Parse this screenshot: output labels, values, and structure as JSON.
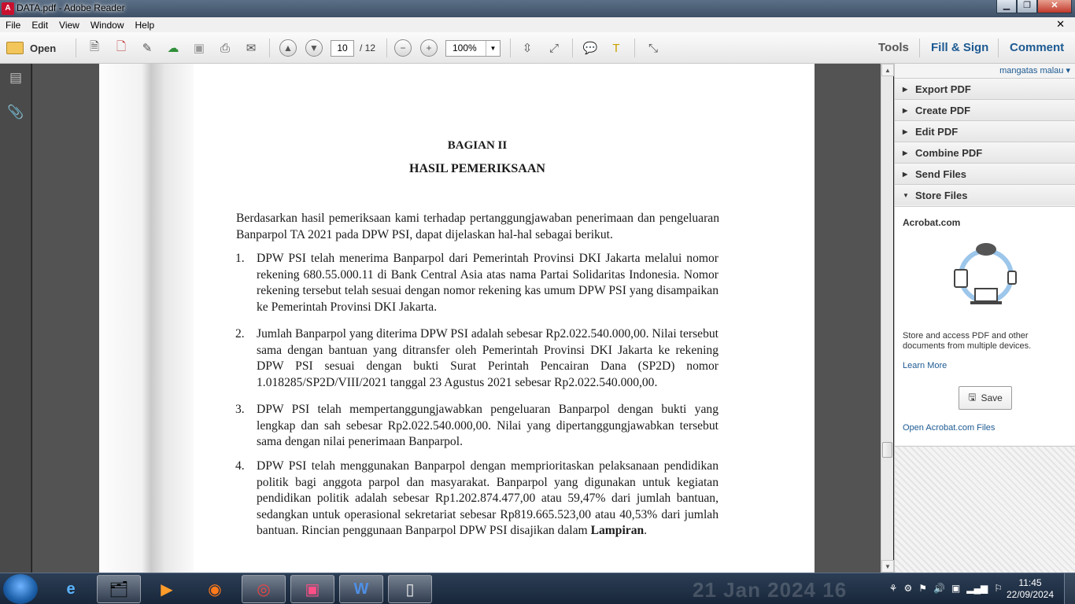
{
  "window": {
    "title": "DATA.pdf - Adobe Reader",
    "minimize": "▁",
    "maximize": "❐",
    "close": "✕"
  },
  "menu": {
    "items": [
      "File",
      "Edit",
      "View",
      "Window",
      "Help"
    ],
    "close": "✕"
  },
  "toolbar": {
    "open_label": "Open",
    "page_current": "10",
    "page_total": "/ 12",
    "zoom": "100%",
    "tools_label": "Tools",
    "fill_sign_label": "Fill & Sign",
    "comment_label": "Comment"
  },
  "document": {
    "heading1": "BAGIAN II",
    "heading2": "HASIL PEMERIKSAAN",
    "intro": "Berdasarkan hasil pemeriksaan kami terhadap pertanggungjawaban penerimaan dan pengeluaran Banparpol TA 2021 pada DPW PSI, dapat dijelaskan hal-hal sebagai berikut.",
    "items": [
      {
        "num": "1.",
        "text": "DPW PSI telah menerima Banparpol dari Pemerintah Provinsi DKI Jakarta melalui nomor rekening 680.55.000.11 di Bank Central Asia atas nama Partai Solidaritas Indonesia. Nomor rekening tersebut telah sesuai dengan nomor rekening kas umum DPW PSI yang disampaikan ke Pemerintah Provinsi DKI Jakarta."
      },
      {
        "num": "2.",
        "text": "Jumlah Banparpol yang diterima DPW PSI adalah sebesar Rp2.022.540.000,00. Nilai tersebut sama dengan bantuan yang ditransfer oleh Pemerintah Provinsi DKI Jakarta ke rekening DPW PSI sesuai dengan bukti Surat Perintah Pencairan Dana (SP2D) nomor 1.018285/SP2D/VIII/2021 tanggal 23 Agustus 2021 sebesar Rp2.022.540.000,00."
      },
      {
        "num": "3.",
        "text": "DPW PSI telah mempertanggungjawabkan pengeluaran Banparpol dengan bukti yang lengkap dan sah sebesar Rp2.022.540.000,00. Nilai yang dipertanggungjawabkan tersebut sama dengan nilai penerimaan Banparpol."
      },
      {
        "num": "4.",
        "text": "DPW PSI telah menggunakan Banparpol dengan memprioritaskan pelaksanaan pendidikan politik bagi anggota parpol dan masyarakat. Banparpol yang digunakan untuk kegiatan pendidikan politik adalah sebesar Rp1.202.874.477,00 atau 59,47% dari jumlah bantuan, sedangkan untuk operasional sekretariat sebesar Rp819.665.523,00 atau 40,53% dari jumlah bantuan. Rincian penggunaan Banparpol DPW PSI disajikan dalam",
        "bold_tail": "Lampiran",
        "tail": "."
      }
    ]
  },
  "right_panel": {
    "user": "mangatas malau",
    "sections": [
      "Export PDF",
      "Create PDF",
      "Edit PDF",
      "Combine PDF",
      "Send Files",
      "Store Files"
    ],
    "acrobat_title": "Acrobat.com",
    "description": "Store and access PDF and other documents from multiple devices.",
    "learn_more": "Learn More",
    "save_label": "Save",
    "open_files": "Open Acrobat.com Files"
  },
  "taskbar": {
    "time": "11:45",
    "date": "22/09/2024",
    "watermark": "21 Jan 2024 16"
  },
  "colors": {
    "link": "#1d5a92",
    "page_bg": "#535353"
  }
}
